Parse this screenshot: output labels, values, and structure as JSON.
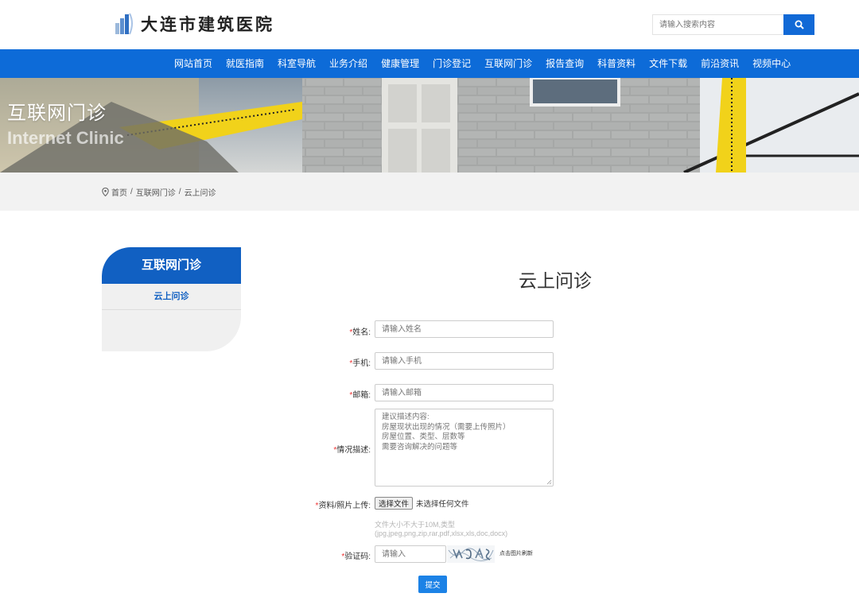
{
  "header": {
    "logo_text": "大连市建筑医院",
    "search_placeholder": "请输入搜索内容"
  },
  "nav": {
    "items": [
      "网站首页",
      "就医指南",
      "科室导航",
      "业务介绍",
      "健康管理",
      "门诊登记",
      "互联网门诊",
      "报告查询",
      "科普资料",
      "文件下载",
      "前沿资讯",
      "视频中心"
    ]
  },
  "banner": {
    "title": "互联网门诊",
    "subtitle": "Internet Clinic"
  },
  "breadcrumb": {
    "home": "首页",
    "level1": "互联网门诊",
    "level2": "云上问诊",
    "separator": "/"
  },
  "sidebar": {
    "title": "互联网门诊",
    "items": [
      "云上问诊"
    ]
  },
  "form": {
    "title": "云上问诊",
    "required_mark": "*",
    "name_label": "姓名:",
    "name_placeholder": "请输入姓名",
    "phone_label": "手机:",
    "phone_placeholder": "请输入手机",
    "email_label": "邮箱:",
    "email_placeholder": "请输入邮箱",
    "desc_label": "情况描述:",
    "desc_placeholder": "建议描述内容:\n房屋现状出现的情况（需要上传照片）\n房屋位置、类型、层数等\n需要咨询解决的问题等",
    "upload_label": "资料/照片上传:",
    "upload_button": "选择文件",
    "upload_status": "未选择任何文件",
    "upload_hint": "文件大小不大于10M,类型(jpg,jpeg,png,zip,rar,pdf,xlsx,xls,doc,docx)",
    "captcha_label": "验证码:",
    "captcha_placeholder": "请输入",
    "captcha_refresh": "点击图片刷新",
    "submit_label": "提交"
  },
  "colors": {
    "primary": "#0d6bd8",
    "sidebar_head": "#1160c2",
    "submit": "#1c82e6",
    "required": "#e33333"
  }
}
